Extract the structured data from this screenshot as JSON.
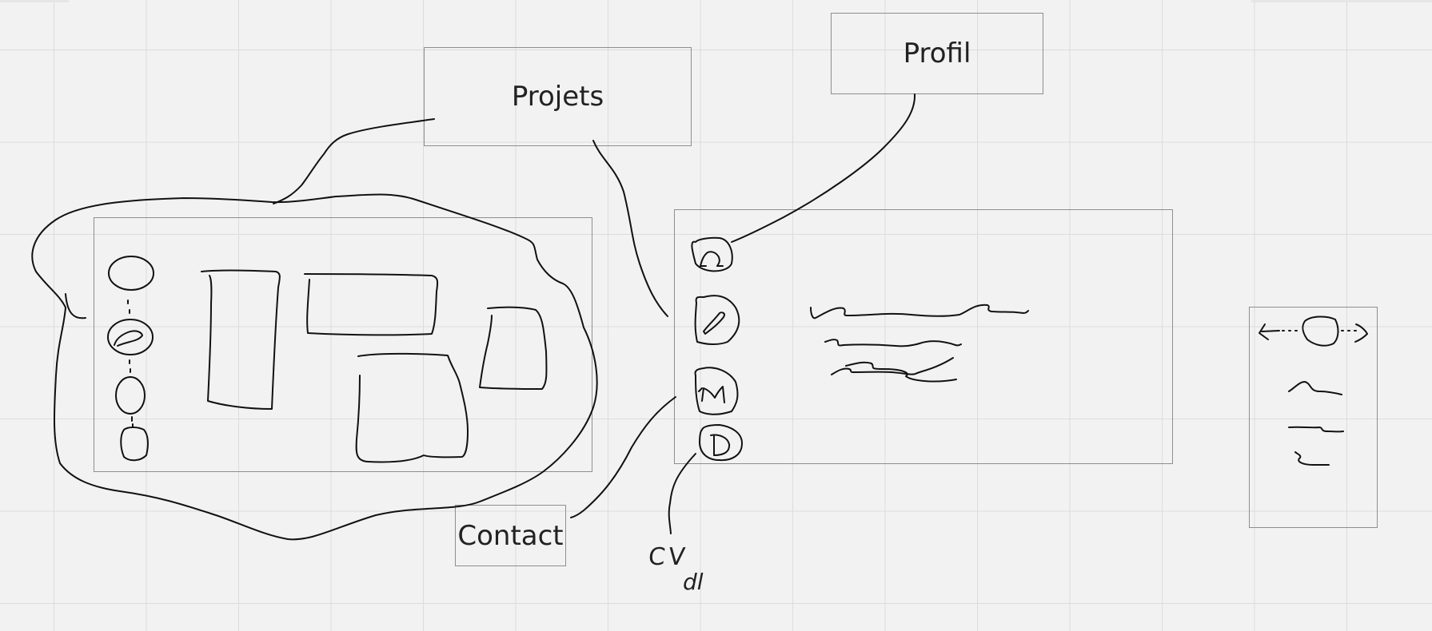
{
  "labels": {
    "projets": "Projets",
    "profil": "Profil",
    "contact": "Contact",
    "cv": "CV",
    "dl": "dl"
  },
  "colors": {
    "background": "#f2f2f2",
    "grid": "#dcdcdc",
    "box_border": "#8e8e8e",
    "ink": "#111111"
  }
}
